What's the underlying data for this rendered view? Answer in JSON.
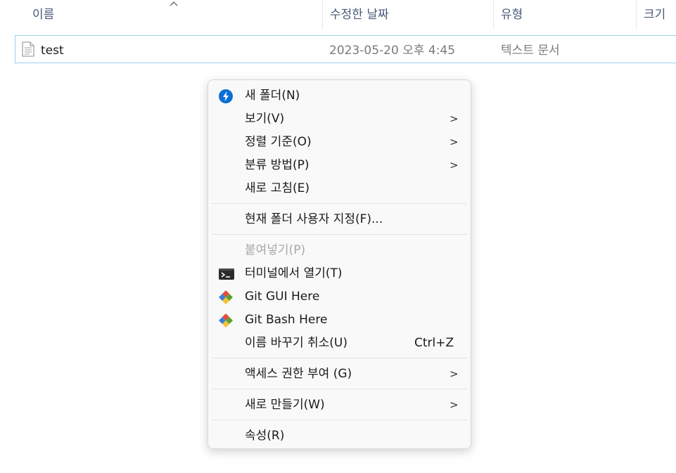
{
  "columns": {
    "name": "이름",
    "modified": "수정한 날짜",
    "type": "유형",
    "size": "크기"
  },
  "file": {
    "name": "test",
    "modified": "2023-05-20 오후 4:45",
    "type": "텍스트 문서",
    "icon": "text-file-icon"
  },
  "menu": {
    "new_folder": {
      "label": "새 폴더(N)",
      "icon": "new-folder-icon",
      "icon_color": "#0a6fd6"
    },
    "view": {
      "label": "보기(V)",
      "chevron": ">"
    },
    "sort_by": {
      "label": "정렬 기준(O)",
      "chevron": ">"
    },
    "group_by": {
      "label": "분류 방법(P)",
      "chevron": ">"
    },
    "refresh": {
      "label": "새로 고침(E)"
    },
    "customize": {
      "label": "현재 폴더 사용자 지정(F)..."
    },
    "paste": {
      "label": "붙여넣기(P)",
      "disabled": true
    },
    "terminal": {
      "label": "터미널에서 열기(T)",
      "icon": "terminal-icon"
    },
    "git_gui": {
      "label": "Git GUI Here",
      "icon": "git-icon"
    },
    "git_bash": {
      "label": "Git Bash Here",
      "icon": "git-icon"
    },
    "undo_rename": {
      "label": "이름 바꾸기 취소(U)",
      "shortcut": "Ctrl+Z"
    },
    "give_access": {
      "label": "액세스 권한 부여 (G)",
      "chevron": ">"
    },
    "new": {
      "label": "새로 만들기(W)",
      "chevron": ">"
    },
    "properties": {
      "label": "속성(R)"
    }
  }
}
